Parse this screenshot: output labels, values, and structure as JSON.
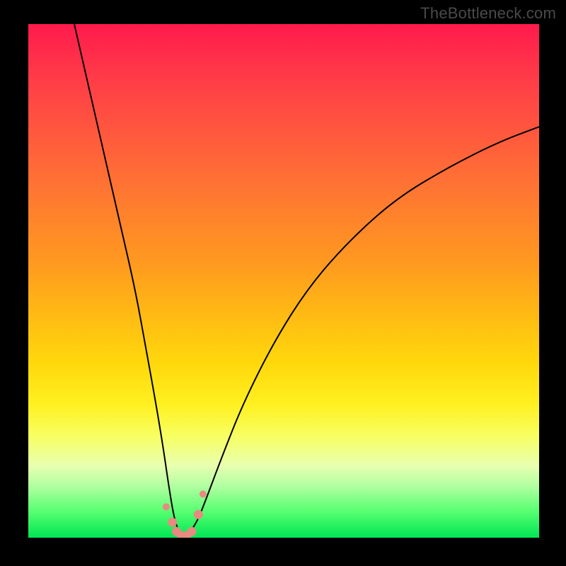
{
  "watermark": "TheBottleneck.com",
  "chart_data": {
    "type": "line",
    "title": "",
    "xlabel": "",
    "ylabel": "",
    "xlim": [
      0,
      100
    ],
    "ylim": [
      0,
      100
    ],
    "series": [
      {
        "name": "bottleneck-curve",
        "x": [
          9,
          12,
          15,
          18,
          21,
          23,
          25,
          26.5,
          27.5,
          28.5,
          29.5,
          30.5,
          31.5,
          33,
          35,
          38,
          42,
          48,
          55,
          63,
          72,
          82,
          92,
          100
        ],
        "values": [
          100,
          87,
          74,
          61,
          48,
          37,
          26,
          17,
          10,
          4,
          1,
          0,
          1,
          3,
          8,
          16,
          26,
          38,
          49,
          58,
          66,
          72,
          77,
          80
        ]
      }
    ],
    "markers": {
      "name": "highlight-dots",
      "color": "#e88a80",
      "x": [
        27.0,
        28.2,
        29.0,
        30.0,
        31.0,
        32.0,
        33.3,
        34.2
      ],
      "values": [
        6.0,
        3.0,
        1.2,
        0.4,
        0.4,
        1.2,
        4.5,
        8.5
      ]
    },
    "gradient_stops": [
      {
        "pos": 0,
        "color": "#ff1a4c"
      },
      {
        "pos": 50,
        "color": "#ffb814"
      },
      {
        "pos": 75,
        "color": "#fff020"
      },
      {
        "pos": 100,
        "color": "#00e554"
      }
    ]
  }
}
